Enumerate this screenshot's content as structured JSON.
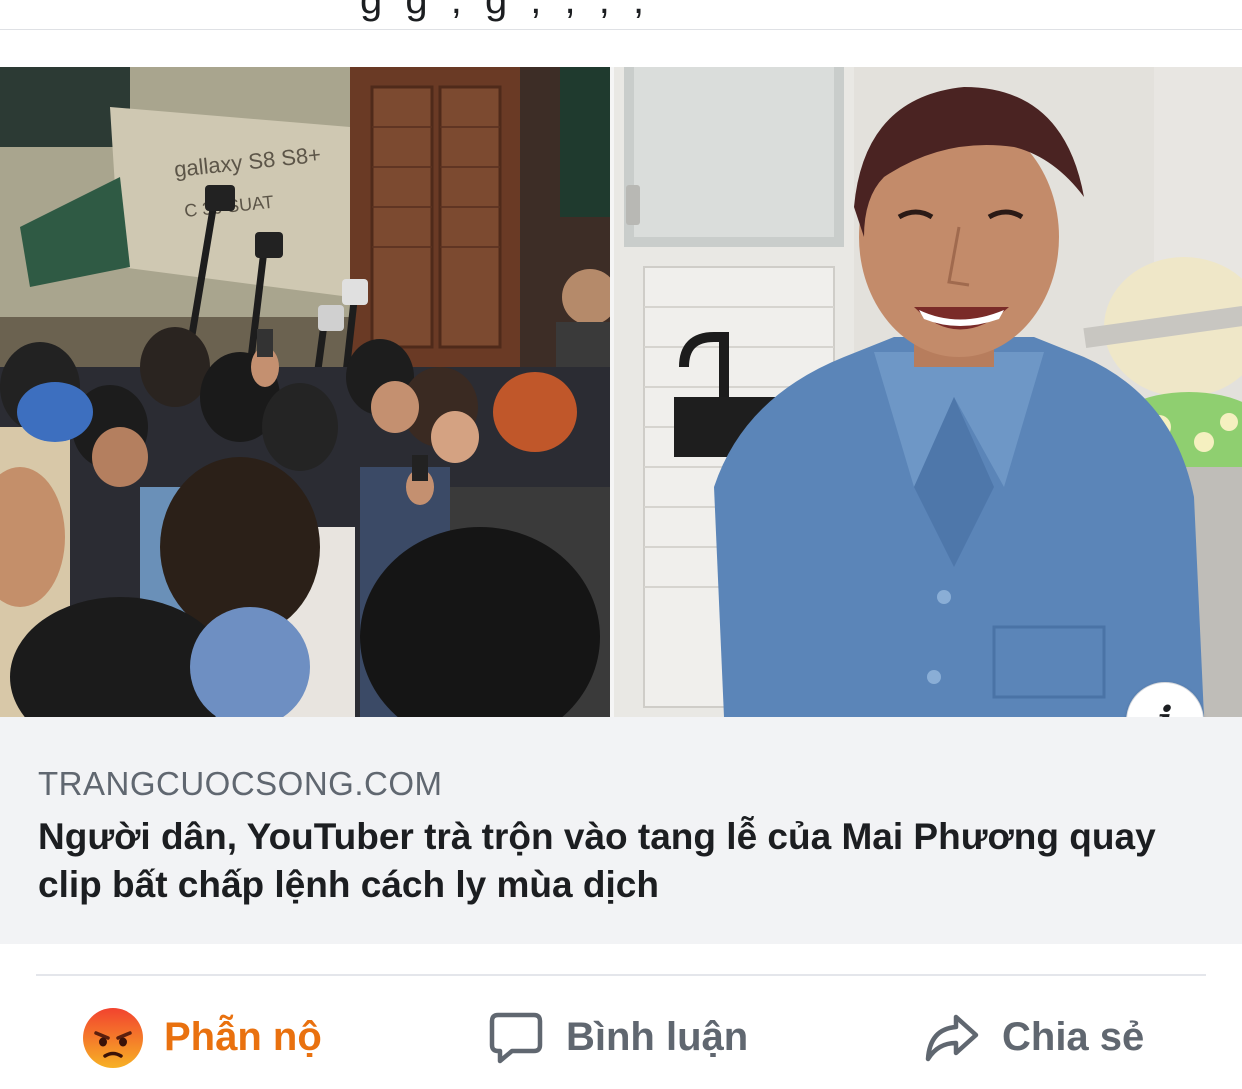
{
  "link_preview": {
    "domain": "TRANGCUOCSONG.COM",
    "headline": "Người dân, YouTuber trà trộn vào tang lễ của Mai Phương quay clip bất chấp lệnh cách ly mùa dịch",
    "info_icon": "info-icon"
  },
  "actions": {
    "react_label": "Phẫn nộ",
    "react_icon": "angry-emoji-icon",
    "comment_label": "Bình luận",
    "comment_icon": "comment-bubble-icon",
    "share_label": "Chia sẻ",
    "share_icon": "share-arrow-icon"
  },
  "colors": {
    "react_active": "#e9710f",
    "muted_text": "#606770",
    "caption_bg": "#f2f3f5"
  }
}
